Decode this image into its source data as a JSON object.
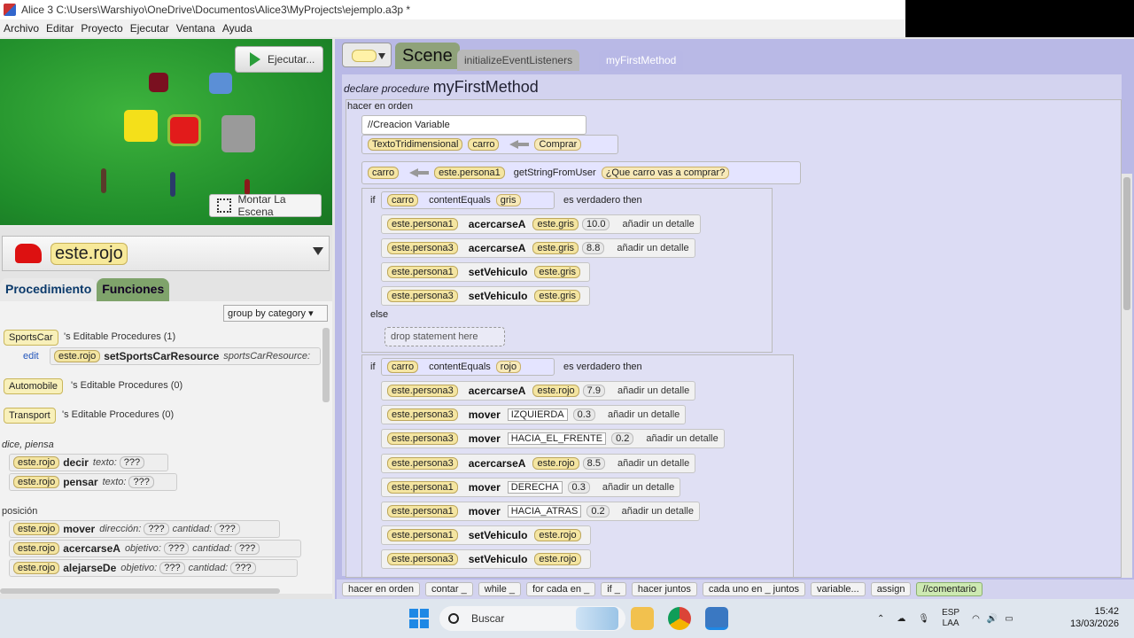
{
  "window": {
    "title": "Alice 3 C:\\Users\\Warshiyo\\OneDrive\\Documentos\\Alice3\\MyProjects\\ejemplo.a3p *"
  },
  "menu": [
    "Archivo",
    "Editar",
    "Proyecto",
    "Ejecutar",
    "Ventana",
    "Ayuda"
  ],
  "scene": {
    "run_label": "Ejecutar...",
    "setup_label": "Montar La Escena"
  },
  "selector": {
    "name": "este.rojo"
  },
  "tabs": {
    "procedures": "Procedimiento",
    "functions": "Funciones"
  },
  "group_by": "group by category",
  "classes": [
    {
      "name": "SportsCar",
      "suffix": "'s Editable Procedures (1)"
    },
    {
      "name": "Automobile",
      "suffix": "'s Editable Procedures (0)"
    },
    {
      "name": "Transport",
      "suffix": "'s Editable Procedures (0)"
    }
  ],
  "edit_label": "edit",
  "sports_proc": {
    "obj": "este.rojo",
    "method": "setSportsCarResource",
    "arg": "sportsCarResource:"
  },
  "cat_say": "dice, piensa",
  "cat_pos": "posición",
  "procs": [
    {
      "obj": "este.rojo",
      "method": "decir",
      "a1": "texto:",
      "q1": "???",
      "a2": "",
      "q2": ""
    },
    {
      "obj": "este.rojo",
      "method": "pensar",
      "a1": "texto:",
      "q1": "???",
      "a2": "",
      "q2": ""
    },
    {
      "obj": "este.rojo",
      "method": "mover",
      "a1": "dirección:",
      "q1": "???",
      "a2": "cantidad:",
      "q2": "???"
    },
    {
      "obj": "este.rojo",
      "method": "acercarseA",
      "a1": "objetivo:",
      "q1": "???",
      "a2": "cantidad:",
      "q2": "???"
    },
    {
      "obj": "este.rojo",
      "method": "alejarseDe",
      "a1": "objetivo:",
      "q1": "???",
      "a2": "cantidad:",
      "q2": "???"
    }
  ],
  "editor": {
    "scene_tab": "Scene",
    "init_tab": "initializeEventListeners",
    "method_tab": "myFirstMethod",
    "declare": "declare procedure",
    "method_name": "myFirstMethod",
    "do_in_order": "hacer en orden",
    "comment": "//Creacion Variable",
    "var_type": "TextoTridimensional",
    "var_name": "carro",
    "var_value": "Comprar",
    "assign_var": "carro",
    "assign_obj": "este.persona1",
    "assign_method": "getStringFromUser",
    "assign_arg": "¿Que carro vas a comprar?",
    "if_kw": "if",
    "then_kw": "es verdadero then",
    "else_kw": "else",
    "contains": "contentEquals",
    "drop": "drop statement here",
    "detail": "añadir un detalle",
    "if1_str": "gris",
    "if1_stmts": [
      {
        "obj": "este.persona1",
        "method": "acercarseA",
        "target": "este.gris",
        "val": "10.0"
      },
      {
        "obj": "este.persona3",
        "method": "acercarseA",
        "target": "este.gris",
        "val": "8.8"
      },
      {
        "obj": "este.persona1",
        "method": "setVehiculo",
        "target": "este.gris",
        "val": ""
      },
      {
        "obj": "este.persona3",
        "method": "setVehiculo",
        "target": "este.gris",
        "val": ""
      }
    ],
    "if2_str": "rojo",
    "if2_stmts": [
      {
        "obj": "este.persona3",
        "method": "acercarseA",
        "target": "este.rojo",
        "val": "7.9",
        "dir": ""
      },
      {
        "obj": "este.persona3",
        "method": "mover",
        "target": "",
        "val": "0.3",
        "dir": "IZQUIERDA"
      },
      {
        "obj": "este.persona3",
        "method": "mover",
        "target": "",
        "val": "0.2",
        "dir": "HACIA_EL_FRENTE"
      },
      {
        "obj": "este.persona3",
        "method": "acercarseA",
        "target": "este.rojo",
        "val": "8.5",
        "dir": ""
      },
      {
        "obj": "este.persona1",
        "method": "mover",
        "target": "",
        "val": "0.3",
        "dir": "DERECHA"
      },
      {
        "obj": "este.persona1",
        "method": "mover",
        "target": "",
        "val": "0.2",
        "dir": "HACIA_ATRAS"
      },
      {
        "obj": "este.persona1",
        "method": "setVehiculo",
        "target": "este.rojo",
        "val": "",
        "dir": ""
      },
      {
        "obj": "este.persona3",
        "method": "setVehiculo",
        "target": "este.rojo",
        "val": "",
        "dir": ""
      }
    ]
  },
  "palette": [
    "hacer en orden",
    "contar _",
    "while _",
    "for cada en _",
    "if _",
    "hacer juntos",
    "cada uno en _ juntos",
    "variable...",
    "assign",
    "//comentario"
  ],
  "taskbar": {
    "search": "Buscar",
    "lang1": "ESP",
    "lang2": "LAA",
    "time": "15:42",
    "date": "13/03/2026"
  }
}
